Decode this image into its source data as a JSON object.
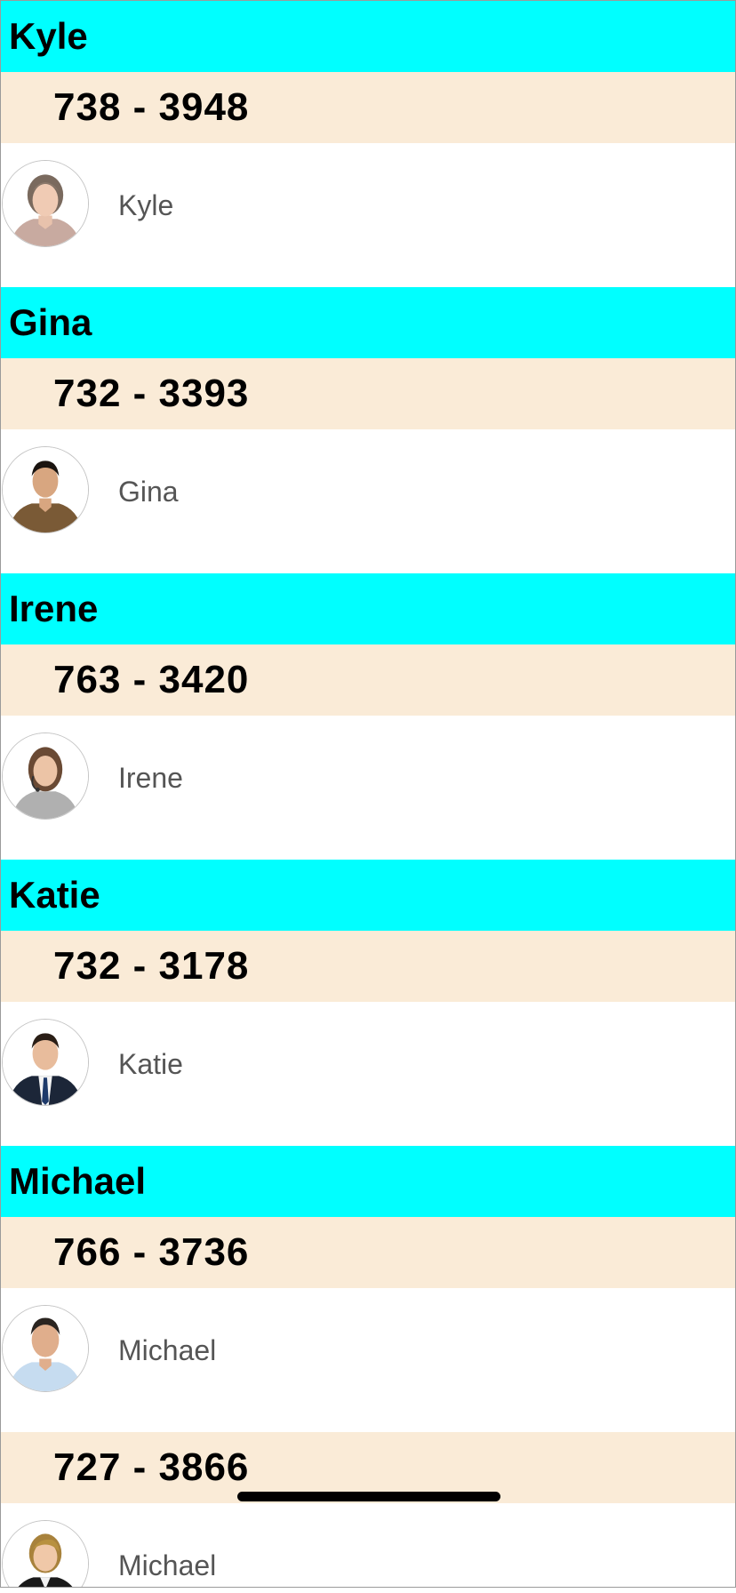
{
  "groups": [
    {
      "header": "Kyle",
      "entries": [
        {
          "phone": "738 - 3948",
          "name": "Kyle",
          "avatar": "avatar-older-woman-grey-hair"
        }
      ]
    },
    {
      "header": "Gina",
      "entries": [
        {
          "phone": "732 - 3393",
          "name": "Gina",
          "avatar": "avatar-young-man-brown-shirt"
        }
      ]
    },
    {
      "header": "Irene",
      "entries": [
        {
          "phone": "763 - 3420",
          "name": "Irene",
          "avatar": "avatar-woman-headset"
        }
      ]
    },
    {
      "header": "Katie",
      "entries": [
        {
          "phone": "732 - 3178",
          "name": "Katie",
          "avatar": "avatar-man-suit-tie"
        }
      ]
    },
    {
      "header": "Michael",
      "entries": [
        {
          "phone": "766 - 3736",
          "name": "Michael",
          "avatar": "avatar-man-light-blue-shirt"
        },
        {
          "phone": "727 - 3866",
          "name": "Michael",
          "avatar": "avatar-blonde-woman-black-blazer"
        }
      ]
    }
  ],
  "colors": {
    "group_header_bg": "#00ffff",
    "phone_row_bg": "#faebd7",
    "contact_name_text": "#555555"
  }
}
